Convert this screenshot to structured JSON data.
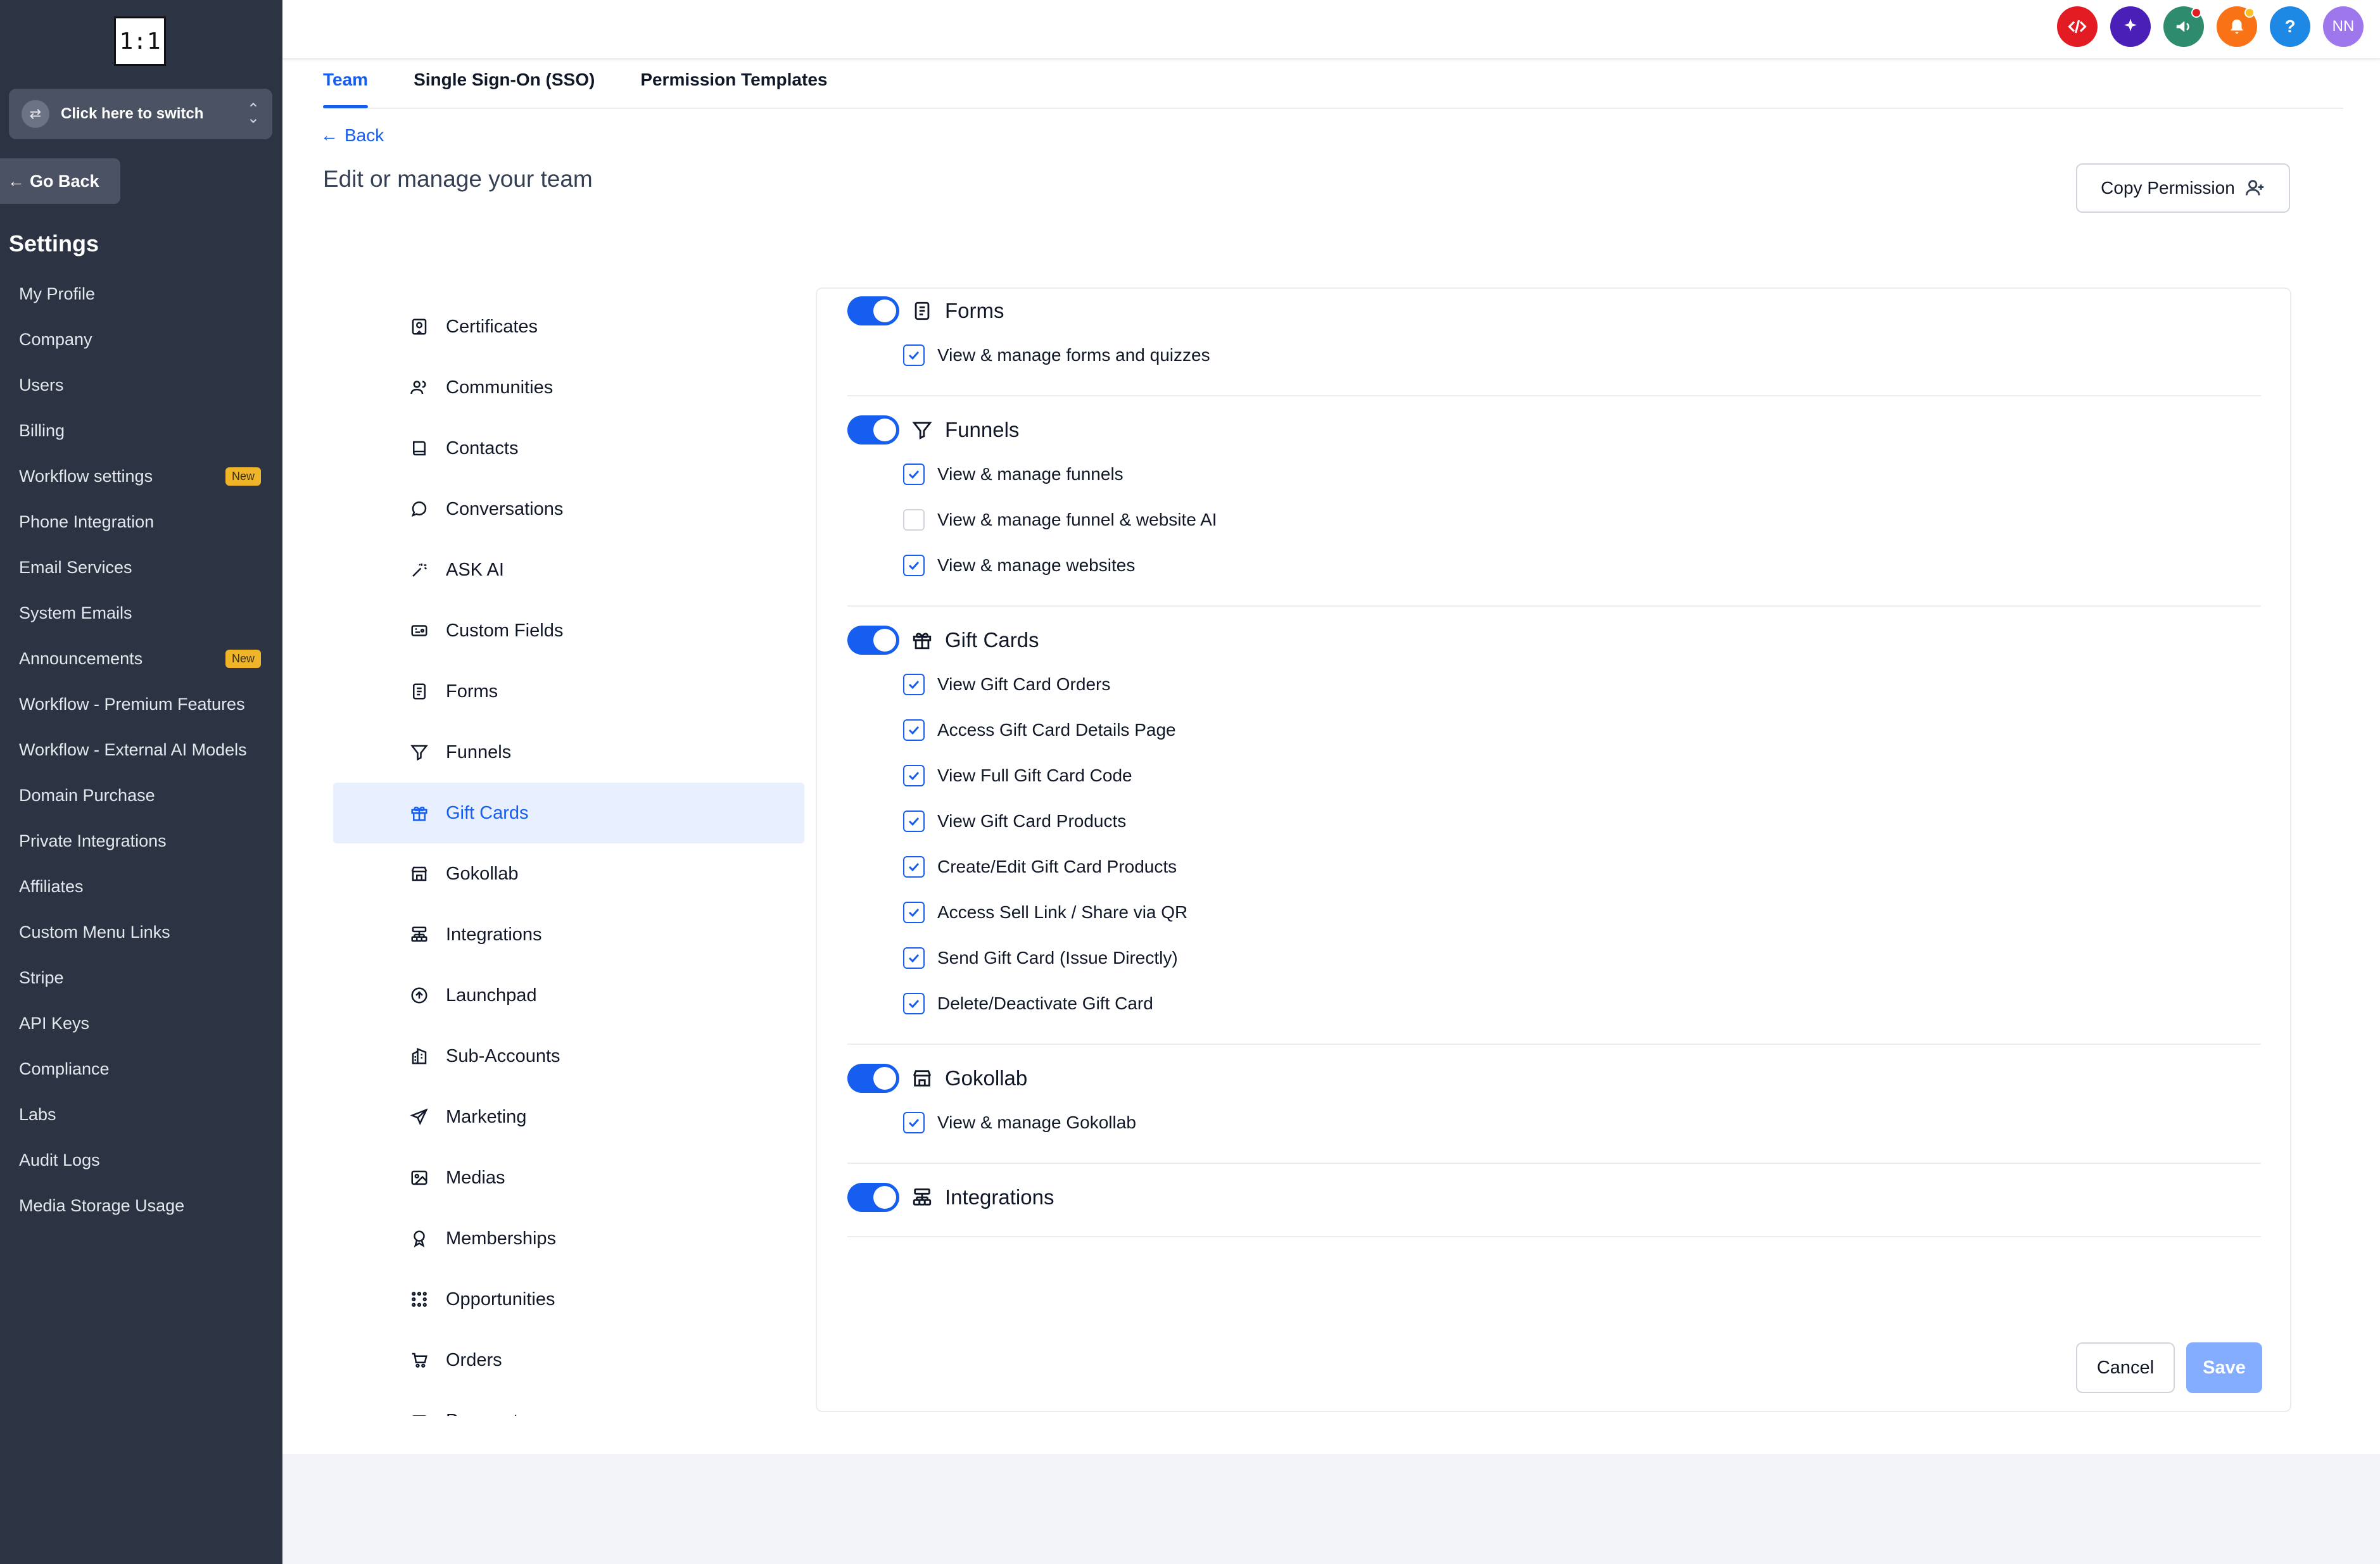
{
  "sidebar": {
    "logo_text": "1:1",
    "switcher_label": "Click here to switch",
    "go_back_label": "Go Back",
    "settings_title": "Settings",
    "items": [
      {
        "label": "My Profile"
      },
      {
        "label": "Company"
      },
      {
        "label": "Users"
      },
      {
        "label": "Billing"
      },
      {
        "label": "Workflow settings",
        "badge": "New"
      },
      {
        "label": "Phone Integration"
      },
      {
        "label": "Email Services"
      },
      {
        "label": "System Emails"
      },
      {
        "label": "Announcements",
        "badge": "New"
      },
      {
        "label": "Workflow - Premium Features"
      },
      {
        "label": "Workflow - External AI Models"
      },
      {
        "label": "Domain Purchase"
      },
      {
        "label": "Private Integrations"
      },
      {
        "label": "Affiliates"
      },
      {
        "label": "Custom Menu Links"
      },
      {
        "label": "Stripe"
      },
      {
        "label": "API Keys"
      },
      {
        "label": "Compliance"
      },
      {
        "label": "Labs"
      },
      {
        "label": "Audit Logs"
      },
      {
        "label": "Media Storage Usage"
      }
    ]
  },
  "topbar": {
    "avatar_initials": "NN",
    "help_glyph": "?",
    "icons": [
      {
        "name": "code-icon",
        "color": "#e31b23"
      },
      {
        "name": "sparkle-icon",
        "color": "#4a1fb8"
      },
      {
        "name": "megaphone-icon",
        "color": "#2e8b6e"
      },
      {
        "name": "bell-icon",
        "color": "#f97316"
      },
      {
        "name": "help-icon",
        "color": "#1e88e5"
      },
      {
        "name": "avatar",
        "color": "#9e77ed"
      }
    ]
  },
  "tabs": [
    "Team",
    "Single Sign-On (SSO)",
    "Permission Templates"
  ],
  "active_tab": "Team",
  "back_label": "Back",
  "page_title": "Edit or manage your team",
  "copy_permission_label": "Copy Permission",
  "permission_menu": [
    {
      "label": "Certificates",
      "icon": "certificate-icon"
    },
    {
      "label": "Communities",
      "icon": "users-icon"
    },
    {
      "label": "Contacts",
      "icon": "book-icon"
    },
    {
      "label": "Conversations",
      "icon": "chat-bubble-icon"
    },
    {
      "label": "ASK AI",
      "icon": "wand-icon"
    },
    {
      "label": "Custom Fields",
      "icon": "fields-icon"
    },
    {
      "label": "Forms",
      "icon": "document-icon"
    },
    {
      "label": "Funnels",
      "icon": "filter-icon"
    },
    {
      "label": "Gift Cards",
      "icon": "gift-icon",
      "active": true
    },
    {
      "label": "Gokollab",
      "icon": "store-icon"
    },
    {
      "label": "Integrations",
      "icon": "hierarchy-icon"
    },
    {
      "label": "Launchpad",
      "icon": "arrow-up-circle-icon"
    },
    {
      "label": "Sub-Accounts",
      "icon": "building-icon"
    },
    {
      "label": "Marketing",
      "icon": "send-icon"
    },
    {
      "label": "Medias",
      "icon": "image-icon"
    },
    {
      "label": "Memberships",
      "icon": "award-icon"
    },
    {
      "label": "Opportunities",
      "icon": "dots-grid-icon"
    },
    {
      "label": "Orders",
      "icon": "cart-icon"
    },
    {
      "label": "Payments",
      "icon": "card-icon"
    }
  ],
  "sections": [
    {
      "title": "Forms",
      "icon": "document-icon",
      "enabled": true,
      "permissions": [
        {
          "label": "View & manage forms and quizzes",
          "checked": true
        }
      ]
    },
    {
      "title": "Funnels",
      "icon": "filter-icon",
      "enabled": true,
      "permissions": [
        {
          "label": "View & manage funnels",
          "checked": true
        },
        {
          "label": "View & manage funnel & website AI",
          "checked": false
        },
        {
          "label": "View & manage websites",
          "checked": true
        }
      ]
    },
    {
      "title": "Gift Cards",
      "icon": "gift-icon",
      "enabled": true,
      "permissions": [
        {
          "label": "View Gift Card Orders",
          "checked": true
        },
        {
          "label": "Access Gift Card Details Page",
          "checked": true
        },
        {
          "label": "View Full Gift Card Code",
          "checked": true
        },
        {
          "label": "View Gift Card Products",
          "checked": true
        },
        {
          "label": "Create/Edit Gift Card Products",
          "checked": true
        },
        {
          "label": "Access Sell Link / Share via QR",
          "checked": true
        },
        {
          "label": "Send Gift Card (Issue Directly)",
          "checked": true
        },
        {
          "label": "Delete/Deactivate Gift Card",
          "checked": true
        }
      ]
    },
    {
      "title": "Gokollab",
      "icon": "store-icon",
      "enabled": true,
      "permissions": [
        {
          "label": "View & manage Gokollab",
          "checked": true
        }
      ]
    },
    {
      "title": "Integrations",
      "icon": "hierarchy-icon",
      "enabled": true,
      "permissions": []
    }
  ],
  "footer": {
    "cancel_label": "Cancel",
    "save_label": "Save"
  },
  "colors": {
    "sidebar_bg": "#2c3444",
    "accent": "#155eef",
    "save_disabled": "#84adff"
  }
}
